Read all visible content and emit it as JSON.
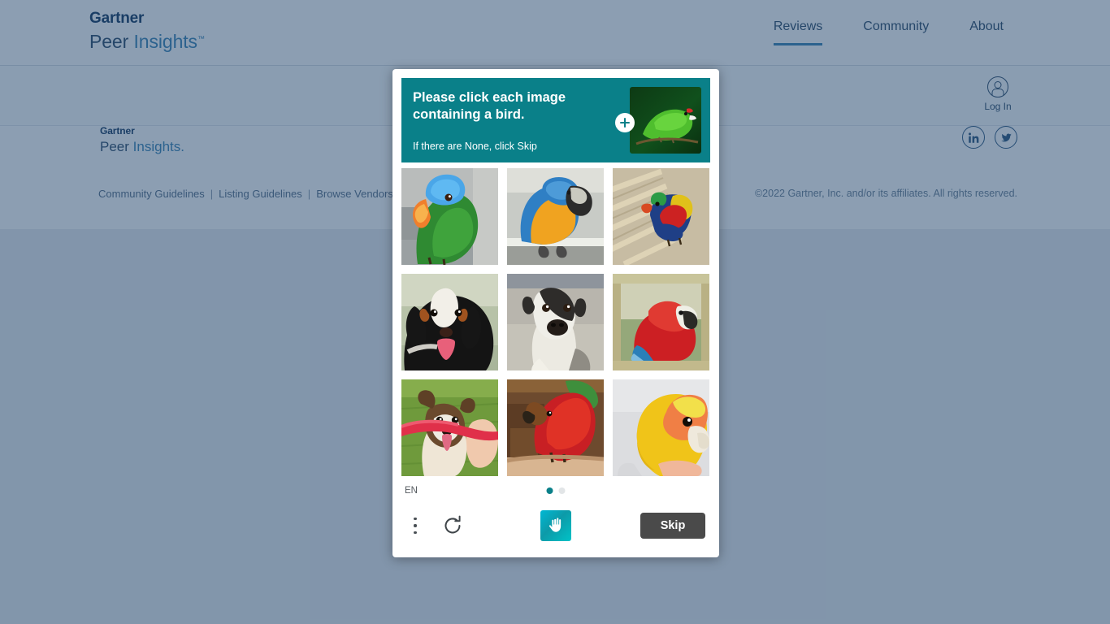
{
  "page": {
    "header": {
      "logo": {
        "gartner": "Gartner",
        "peer": "Peer",
        "insights": "Insights",
        "tm": "™"
      },
      "nav": [
        {
          "label": "Reviews",
          "active": true
        },
        {
          "label": "Community",
          "active": false
        },
        {
          "label": "About",
          "active": false
        }
      ],
      "login": {
        "label": "Log In",
        "icon": "user-circle-icon"
      }
    },
    "footer": {
      "logo": {
        "gartner": "Gartner",
        "peer": "Peer",
        "insights": "Insights",
        "dot": "."
      },
      "links": [
        "Community Guidelines",
        "Listing Guidelines",
        "Browse Vendors"
      ],
      "separator": "|",
      "copyright": "©2022 Gartner, Inc. and/or its affiliates. All rights reserved.",
      "social": [
        {
          "name": "linkedin-icon",
          "label": "in"
        },
        {
          "name": "twitter-icon",
          "label": "twitter"
        }
      ]
    }
  },
  "captcha": {
    "prompt": {
      "title": "Please click each image containing a bird.",
      "subtitle": "If there are None, click Skip",
      "example_alt": "green-parrot-example",
      "add_icon": "plus-icon"
    },
    "tiles": [
      {
        "id": 1,
        "alt": "blue-headed-green-parrot",
        "is_target": true
      },
      {
        "id": 2,
        "alt": "blue-and-gold-macaw",
        "is_target": true
      },
      {
        "id": 3,
        "alt": "rainbow-lorikeet",
        "is_target": true
      },
      {
        "id": 4,
        "alt": "bernese-mountain-dog",
        "is_target": false
      },
      {
        "id": 5,
        "alt": "black-and-white-dog",
        "is_target": false
      },
      {
        "id": 6,
        "alt": "scarlet-macaw",
        "is_target": true
      },
      {
        "id": 7,
        "alt": "husky-dog-with-toy",
        "is_target": false
      },
      {
        "id": 8,
        "alt": "red-parrot",
        "is_target": true
      },
      {
        "id": 9,
        "alt": "yellow-orange-caique-parrot",
        "is_target": true
      }
    ],
    "language": "EN",
    "pagination": {
      "total": 2,
      "current": 1
    },
    "controls": {
      "menu_icon": "kebab-menu-icon",
      "refresh_icon": "refresh-icon",
      "brand_icon": "hcaptcha-hand-icon",
      "skip_label": "Skip"
    }
  },
  "colors": {
    "teal": "#0a8089",
    "navy": "#002856",
    "accent_blue": "#2a7ab0",
    "skip_gray": "#4a4a4a",
    "scrim": "#2e4f73"
  }
}
